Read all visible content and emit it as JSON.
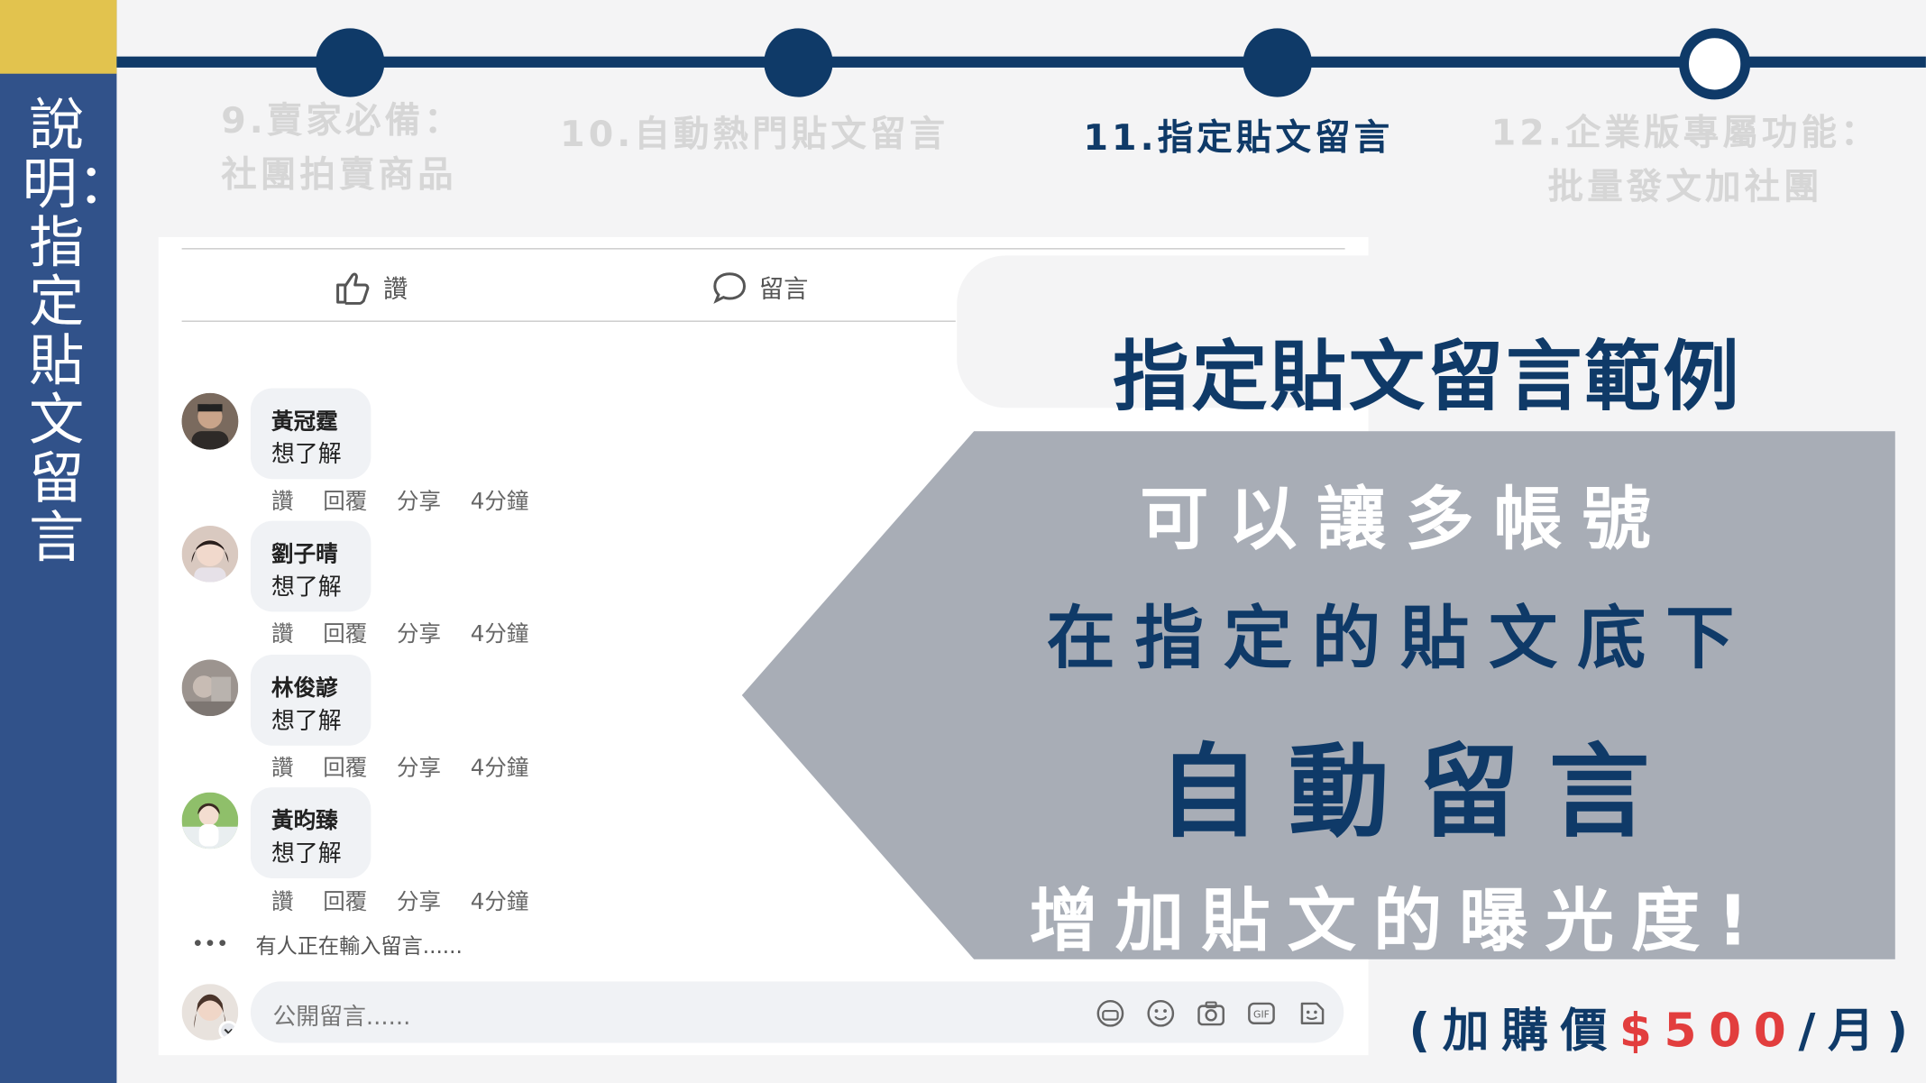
{
  "sidebar": {
    "title": "說明：指定貼文留言"
  },
  "timeline": {
    "steps": [
      {
        "line1": "9.賣家必備：",
        "line2": "社團拍賣商品"
      },
      {
        "line1": "10.自動熱門貼文留言"
      },
      {
        "line1": "11.指定貼文留言"
      },
      {
        "line1": "12.企業版專屬功能：",
        "line2": "批量發文加社團"
      }
    ]
  },
  "post": {
    "like_label": "讚",
    "comment_label": "留言",
    "comments": [
      {
        "name": "黃冠霆",
        "text": "想了解",
        "actions": [
          "讚",
          "回覆",
          "分享",
          "4分鐘"
        ]
      },
      {
        "name": "劉子晴",
        "text": "想了解",
        "actions": [
          "讚",
          "回覆",
          "分享",
          "4分鐘"
        ]
      },
      {
        "name": "林俊諺",
        "text": "想了解",
        "actions": [
          "讚",
          "回覆",
          "分享",
          "4分鐘"
        ]
      },
      {
        "name": "黃昀臻",
        "text": "想了解",
        "actions": [
          "讚",
          "回覆",
          "分享",
          "4分鐘"
        ]
      }
    ],
    "typing_dots": "•••",
    "typing": "有人正在輸入留言......",
    "input_placeholder": "公開留言......",
    "gif_label": "GIF"
  },
  "title": "指定貼文留言範例",
  "callout": {
    "line1": "可以讓多帳號",
    "line2": "在指定的貼文底下",
    "line3": "自動留言",
    "line4": "增加貼文的曝光度!"
  },
  "price": {
    "open": "(加購價",
    "amount": "$500",
    "close": "/月)"
  },
  "colors": {
    "navy": "#0f3a68",
    "sidebar": "#31528a",
    "gold": "#e2c34e",
    "callout": "#a8adb6",
    "red": "#e23e3e"
  }
}
